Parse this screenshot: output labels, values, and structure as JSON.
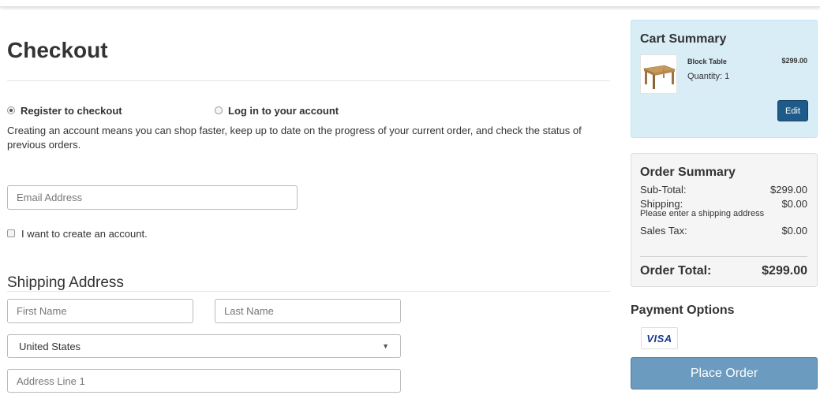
{
  "page": {
    "title": "Checkout"
  },
  "account": {
    "option_register": "Register to checkout",
    "option_login": "Log in to your account",
    "intro": "Creating an account means you can shop faster, keep up to date on the progress of your current order, and check the status of previous orders.",
    "email_placeholder": "Email Address",
    "create_account_label": "I want to create an account."
  },
  "shipping": {
    "title": "Shipping Address",
    "first_name_placeholder": "First Name",
    "last_name_placeholder": "Last Name",
    "country_value": "United States",
    "address1_placeholder": "Address Line 1"
  },
  "cart": {
    "title": "Cart Summary",
    "item_name": "Block Table",
    "item_price": "$299.00",
    "item_quantity": "Quantity: 1",
    "edit_label": "Edit"
  },
  "order": {
    "title": "Order Summary",
    "subtotal_label": "Sub-Total:",
    "subtotal_value": "$299.00",
    "shipping_label": "Shipping:",
    "shipping_value": "$0.00",
    "shipping_note": "Please enter a shipping address",
    "tax_label": "Sales Tax:",
    "tax_value": "$0.00",
    "total_label": "Order Total:",
    "total_value": "$299.00"
  },
  "payment": {
    "title": "Payment Options",
    "card_brand": "VISA",
    "place_order_label": "Place Order"
  },
  "icons": {
    "caret": "chevron-down-icon",
    "thumbnail": "table-product-image"
  }
}
